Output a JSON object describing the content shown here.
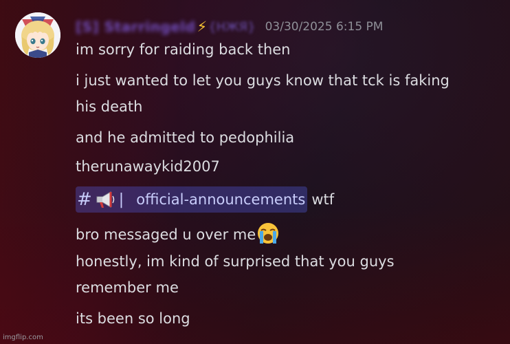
{
  "message": {
    "username": "[S] Starringeld",
    "username_tag": "{HЖЯ}",
    "timestamp": "03/30/2025 6:15 PM",
    "lines": [
      "im sorry for raiding back then",
      "i just wanted to let you guys know that tck is faking",
      "his death",
      "and he admitted to pedophilia",
      "therunawaykid2007"
    ],
    "mention_line": {
      "hash": "#",
      "bar": "|",
      "channel_name": "official-announcements",
      "trailing_text": "wtf"
    },
    "line_with_emoji": "bro messaged u over me",
    "lines_after": [
      "honestly, im kind of surprised that you guys",
      "remember me",
      "its been so long"
    ]
  },
  "icons": {
    "bolt": "⚡",
    "megaphone": "megaphone-icon",
    "crying": "loudly-crying-face-icon"
  },
  "colors": {
    "username": "#6f4bb8",
    "mention_bg": "#3a3f7a",
    "mention_text": "#c9cdfb",
    "timestamp": "#8f9098"
  },
  "watermark": "imgflip.com"
}
